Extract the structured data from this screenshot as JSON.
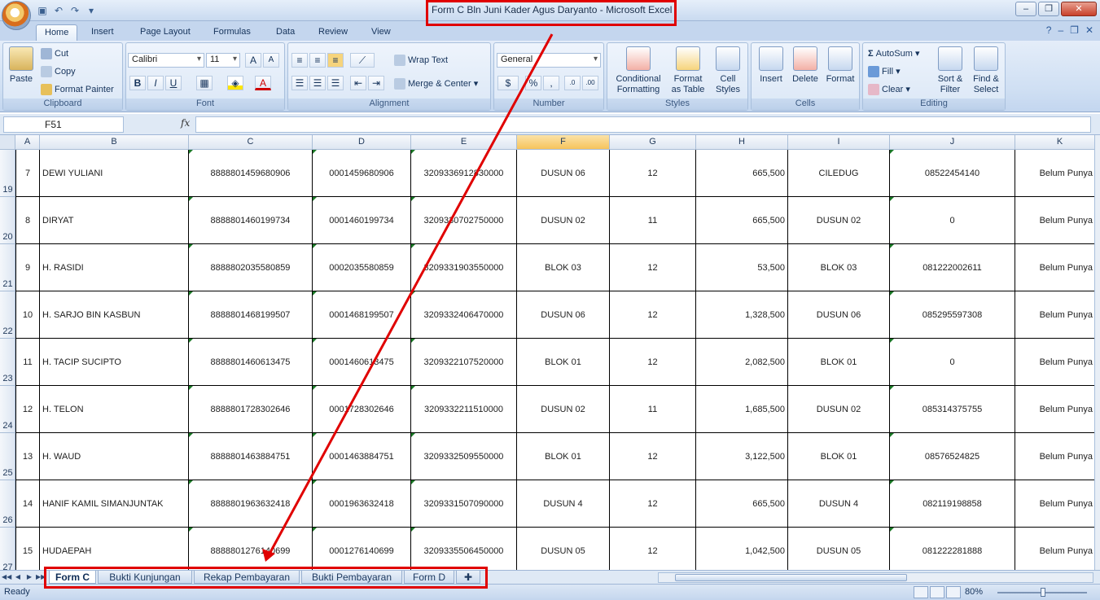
{
  "window": {
    "title": "Form C Bln Juni Kader Agus Daryanto  -  Microsoft Excel"
  },
  "ribbon_tabs": [
    "Home",
    "Insert",
    "Page Layout",
    "Formulas",
    "Data",
    "Review",
    "View"
  ],
  "clipboard": {
    "paste": "Paste",
    "cut": "Cut",
    "copy": "Copy",
    "format_painter": "Format Painter",
    "label": "Clipboard"
  },
  "font": {
    "name": "Calibri",
    "size": "11",
    "bold": "B",
    "italic": "I",
    "underline": "U",
    "grow": "A",
    "shrink": "A",
    "label": "Font"
  },
  "alignment": {
    "wrap_text": "Wrap Text",
    "merge_center": "Merge & Center",
    "label": "Alignment"
  },
  "number": {
    "format": "General",
    "currency": "$",
    "percent": "%",
    "comma": ",",
    "label": "Number"
  },
  "styles": {
    "conditional": [
      "Conditional",
      "Formatting"
    ],
    "format_table": [
      "Format",
      "as Table"
    ],
    "cell_styles": [
      "Cell",
      "Styles"
    ],
    "label": "Styles"
  },
  "cells": {
    "insert": "Insert",
    "delete": "Delete",
    "format": "Format",
    "label": "Cells"
  },
  "editing": {
    "autosum": "AutoSum",
    "fill": "Fill",
    "clear": "Clear",
    "sort_filter": [
      "Sort &",
      "Filter"
    ],
    "find_select": [
      "Find &",
      "Select"
    ],
    "label": "Editing"
  },
  "formula_bar": {
    "name_box": "F51",
    "fx": "fx",
    "value": ""
  },
  "columns": [
    "A",
    "B",
    "C",
    "D",
    "E",
    "F",
    "G",
    "H",
    "I",
    "J",
    "K"
  ],
  "selected_column": "F",
  "rows": [
    {
      "row_num": "19",
      "a": "7",
      "b": "DEWI YULIANI",
      "c": "8888801459680906",
      "d": "0001459680906",
      "e": "3209336912830000",
      "f": "DUSUN 06",
      "g": "12",
      "h": "665,500",
      "i": "CILEDUG",
      "j": "08522454140",
      "k": "Belum Punya U"
    },
    {
      "row_num": "20",
      "a": "8",
      "b": "DIRYAT",
      "c": "8888801460199734",
      "d": "0001460199734",
      "e": "3209330702750000",
      "f": "DUSUN 02",
      "g": "11",
      "h": "665,500",
      "i": "DUSUN 02",
      "j": "0",
      "k": "Belum Punya U"
    },
    {
      "row_num": "21",
      "a": "9",
      "b": "H. RASIDI",
      "c": "8888802035580859",
      "d": "0002035580859",
      "e": "3209331903550000",
      "f": "BLOK 03",
      "g": "12",
      "h": "53,500",
      "i": "BLOK 03",
      "j": "081222002611",
      "k": "Belum Punya U"
    },
    {
      "row_num": "22",
      "a": "10",
      "b": "H. SARJO BIN KASBUN",
      "c": "8888801468199507",
      "d": "0001468199507",
      "e": "3209332406470000",
      "f": "DUSUN 06",
      "g": "12",
      "h": "1,328,500",
      "i": "DUSUN 06",
      "j": "085295597308",
      "k": "Belum Punya U"
    },
    {
      "row_num": "23",
      "a": "11",
      "b": "H. TACIP SUCIPTO",
      "c": "8888801460613475",
      "d": "0001460613475",
      "e": "3209322107520000",
      "f": "BLOK 01",
      "g": "12",
      "h": "2,082,500",
      "i": "BLOK 01",
      "j": "0",
      "k": "Belum Punya U"
    },
    {
      "row_num": "24",
      "a": "12",
      "b": "H. TELON",
      "c": "8888801728302646",
      "d": "0001728302646",
      "e": "3209332211510000",
      "f": "DUSUN 02",
      "g": "11",
      "h": "1,685,500",
      "i": "DUSUN 02",
      "j": "085314375755",
      "k": "Belum Punya U"
    },
    {
      "row_num": "25",
      "a": "13",
      "b": "H. WAUD",
      "c": "8888801463884751",
      "d": "0001463884751",
      "e": "3209332509550000",
      "f": "BLOK 01",
      "g": "12",
      "h": "3,122,500",
      "i": "BLOK 01",
      "j": "08576524825",
      "k": "Belum Punya U"
    },
    {
      "row_num": "26",
      "a": "14",
      "b": "HANIF KAMIL SIMANJUNTAK",
      "c": "8888801963632418",
      "d": "0001963632418",
      "e": "3209331507090000",
      "f": "DUSUN 4",
      "g": "12",
      "h": "665,500",
      "i": "DUSUN 4",
      "j": "082119198858",
      "k": "Belum Punya U"
    },
    {
      "row_num": "27",
      "a": "15",
      "b": "HUDAEPAH",
      "c": "8888801276140699",
      "d": "0001276140699",
      "e": "3209335506450000",
      "f": "DUSUN 05",
      "g": "12",
      "h": "1,042,500",
      "i": "DUSUN 05",
      "j": "081222281888",
      "k": "Belum Punya U"
    }
  ],
  "sheet_tabs": [
    "Form C",
    "Bukti Kunjungan",
    "Rekap Pembayaran",
    "Bukti Pembayaran",
    "Form D"
  ],
  "active_sheet": "Form C",
  "status": {
    "ready": "Ready",
    "zoom": "80%"
  },
  "colors": {
    "annotation_red": "#e00000",
    "ribbon_blue": "#c4d6ee",
    "selected_header": "#f6c35c"
  }
}
